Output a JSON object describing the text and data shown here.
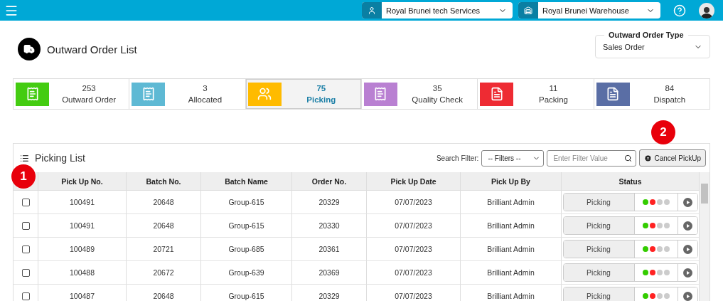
{
  "topbar": {
    "company_select": {
      "value": "Royal Brunei tech Services"
    },
    "warehouse_select": {
      "value": "Royal Brunei Warehouse"
    }
  },
  "page": {
    "title": "Outward Order List",
    "order_type": {
      "label": "Outward Order Type",
      "value": "Sales Order"
    }
  },
  "stats": [
    {
      "count": "253",
      "label": "Outward Order",
      "color": "#44cc11",
      "kind": "receipt",
      "selected": false
    },
    {
      "count": "3",
      "label": "Allocated",
      "color": "#5eb9d4",
      "kind": "receipt",
      "selected": false
    },
    {
      "count": "75",
      "label": "Picking",
      "color": "#ffbb00",
      "kind": "people",
      "selected": true
    },
    {
      "count": "35",
      "label": "Quality Check",
      "color": "#b980d2",
      "kind": "receipt",
      "selected": false
    },
    {
      "count": "11",
      "label": "Packing",
      "color": "#ee2b33",
      "kind": "document",
      "selected": false
    },
    {
      "count": "84",
      "label": "Dispatch",
      "color": "#5a6ea5",
      "kind": "document",
      "selected": false
    }
  ],
  "panel": {
    "title": "Picking List",
    "search_label": "Search Filter:",
    "filter_select": "-- Filters --",
    "filter_placeholder": "Enter Filter Value",
    "cancel_button": "Cancel PickUp"
  },
  "table": {
    "columns": [
      "Pick Up No.",
      "Batch No.",
      "Batch Name",
      "Order No.",
      "Pick Up Date",
      "Pick Up By",
      "Status"
    ],
    "rows": [
      {
        "checked": false,
        "cells": [
          "100491",
          "20648",
          "Group-615",
          "20329",
          "07/07/2023",
          "Brilliant Admin"
        ],
        "status": "Picking",
        "dots": [
          {
            "color": "#33cc00"
          },
          {
            "color": "#ff2222"
          },
          {
            "color": "#cccccc"
          },
          {
            "color": "#cccccc"
          }
        ]
      },
      {
        "checked": false,
        "cells": [
          "100491",
          "20648",
          "Group-615",
          "20330",
          "07/07/2023",
          "Brilliant Admin"
        ],
        "status": "Picking",
        "dots": [
          {
            "color": "#33cc00"
          },
          {
            "color": "#ff2222"
          },
          {
            "color": "#cccccc"
          },
          {
            "color": "#cccccc"
          }
        ]
      },
      {
        "checked": false,
        "cells": [
          "100489",
          "20721",
          "Group-685",
          "20361",
          "07/07/2023",
          "Brilliant Admin"
        ],
        "status": "Picking",
        "dots": [
          {
            "color": "#33cc00"
          },
          {
            "color": "#ff2222"
          },
          {
            "color": "#cccccc"
          },
          {
            "color": "#cccccc"
          }
        ]
      },
      {
        "checked": false,
        "cells": [
          "100488",
          "20672",
          "Group-639",
          "20369",
          "07/07/2023",
          "Brilliant Admin"
        ],
        "status": "Picking",
        "dots": [
          {
            "color": "#33cc00"
          },
          {
            "color": "#ff2222"
          },
          {
            "color": "#cccccc"
          },
          {
            "color": "#cccccc"
          }
        ]
      },
      {
        "checked": false,
        "cells": [
          "100487",
          "20648",
          "Group-615",
          "20329",
          "07/07/2023",
          "Brilliant Admin"
        ],
        "status": "Picking",
        "dots": [
          {
            "color": "#33cc00"
          },
          {
            "color": "#ff2222"
          },
          {
            "color": "#cccccc"
          },
          {
            "color": "#cccccc"
          }
        ]
      }
    ]
  },
  "annotations": [
    "1",
    "2"
  ]
}
